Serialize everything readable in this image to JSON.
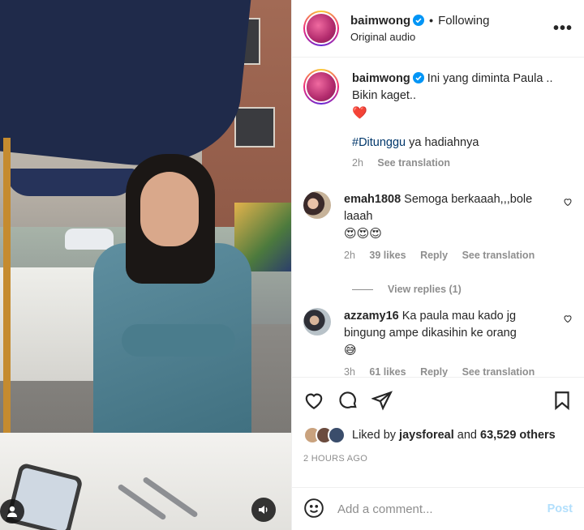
{
  "header": {
    "username": "baimwong",
    "follow_status": "Following",
    "subtitle": "Original audio",
    "more_label": "•••"
  },
  "caption": {
    "username": "baimwong",
    "text": "Ini yang diminta Paula .. Bikin kaget..",
    "emoji_line": "❤️",
    "hashtag": "#Ditunggu",
    "text_after_hashtag": " ya hadiahnya",
    "time": "2h",
    "see_translation": "See translation"
  },
  "comments": [
    {
      "username": "emah1808",
      "text": "Semoga berkaaah,,,bole laaah",
      "emojis": "😍😍😍",
      "time": "2h",
      "likes": "39 likes",
      "reply": "Reply",
      "see_translation": "See translation"
    },
    {
      "username": "azzamy16",
      "text": "Ka paula mau kado jg bingung ampe dikasihin ke orang",
      "emojis": "😅",
      "time": "3h",
      "likes": "61 likes",
      "reply": "Reply",
      "see_translation": "See translation"
    }
  ],
  "view_replies": "View replies (1)",
  "likes": {
    "prefix": "Liked by ",
    "user": "jaysforeal",
    "middle": " and ",
    "count": "63,529 others"
  },
  "timestamp": "2 HOURS AGO",
  "add_comment": {
    "placeholder": "Add a comment...",
    "post_label": "Post"
  },
  "colors": {
    "link": "#00376b",
    "verified": "#0095f6",
    "heart": "#ed4956",
    "post_disabled": "#b2dffc"
  }
}
